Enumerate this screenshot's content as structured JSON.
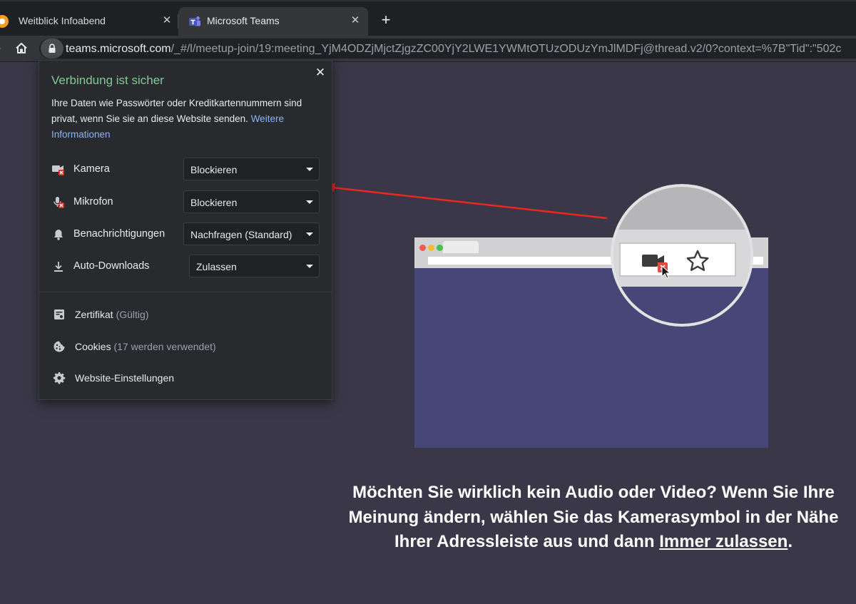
{
  "tabs": [
    {
      "title": "Weitblick Infoabend",
      "active": false
    },
    {
      "title": "Microsoft Teams",
      "active": true
    }
  ],
  "tab_close_glyph": "✕",
  "new_tab_glyph": "+",
  "toolbar": {
    "url_host": "teams.microsoft.com",
    "url_path": "/_#/l/meetup-join/19:meeting_YjM4ODZjMjctZjgzZC00YjY2LWE1YWMtOTUzODUzYmJlMDFj@thread.v2/0?context=%7B\"Tid\":\"502c"
  },
  "popup": {
    "close_glyph": "✕",
    "heading": "Verbindung ist sicher",
    "description": "Ihre Daten wie Passwörter oder Kreditkartennummern sind privat, wenn Sie sie an diese Website senden.",
    "more_info_link": "Weitere Informationen",
    "permissions": [
      {
        "label": "Kamera",
        "value": "Blockieren",
        "icon": "camera-blocked-icon"
      },
      {
        "label": "Mikrofon",
        "value": "Blockieren",
        "icon": "microphone-blocked-icon"
      },
      {
        "label": "Benachrichtigungen",
        "value": "Nachfragen (Standard)",
        "icon": "bell-icon"
      },
      {
        "label": "Auto-Downloads",
        "value": "Zulassen",
        "icon": "download-icon"
      }
    ],
    "links": [
      {
        "label": "Zertifikat",
        "sub": "(Gültig)",
        "icon": "certificate-icon"
      },
      {
        "label": "Cookies",
        "sub": "(17 werden verwendet)",
        "icon": "cookie-icon"
      },
      {
        "label": "Website-Einstellungen",
        "sub": "",
        "icon": "gear-icon"
      }
    ]
  },
  "page": {
    "caption_text": "Möchten Sie wirklich kein Audio oder Video? Wenn Sie Ihre Meinung ändern, wählen Sie das Kamerasymbol in der Nähe Ihrer Adressleiste aus und dann",
    "caption_link": "Immer zulassen",
    "caption_end": "."
  },
  "colors": {
    "page_bg": "#3a3848",
    "illustration_bg": "#474777",
    "secure_green": "#81c995",
    "link_blue": "#8ab4f8",
    "arrow_red": "#e8281e"
  }
}
